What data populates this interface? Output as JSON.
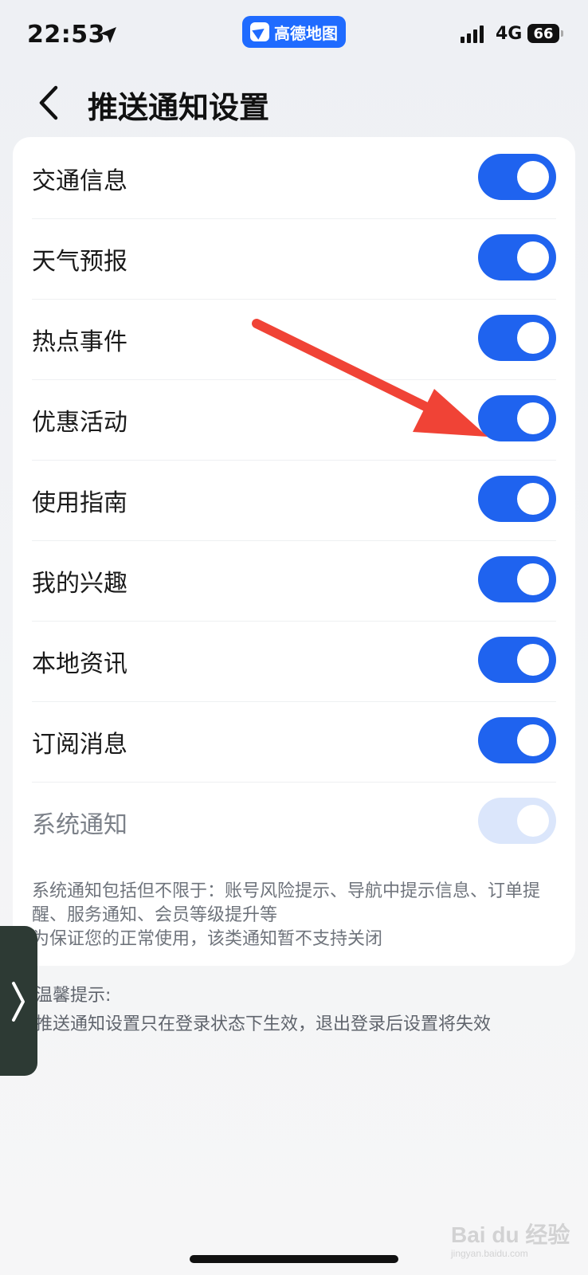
{
  "status_bar": {
    "time": "22:53",
    "app_badge": "高德地图",
    "network": "4G",
    "battery": "66"
  },
  "header": {
    "title": "推送通知设置"
  },
  "settings": [
    {
      "label": "交通信息",
      "enabled": true
    },
    {
      "label": "天气预报",
      "enabled": true
    },
    {
      "label": "热点事件",
      "enabled": true
    },
    {
      "label": "优惠活动",
      "enabled": true
    },
    {
      "label": "使用指南",
      "enabled": true
    },
    {
      "label": "我的兴趣",
      "enabled": true
    },
    {
      "label": "本地资讯",
      "enabled": true
    },
    {
      "label": "订阅消息",
      "enabled": true
    },
    {
      "label": "系统通知",
      "enabled": true,
      "locked": true
    }
  ],
  "system_note": {
    "line1": "系统通知包括但不限于：账号风险提示、导航中提示信息、订单提醒、服务通知、会员等级提升等",
    "line2": "为保证您的正常使用，该类通知暂不支持关闭"
  },
  "tips": {
    "heading": "温馨提示:",
    "body": "推送通知设置只在登录状态下生效，退出登录后设置将失效"
  },
  "watermark": {
    "brand": "Bai du 经验",
    "url": "jingyan.baidu.com"
  },
  "colors": {
    "accent": "#1f63ef",
    "disabled_toggle": "#dbe6fb",
    "arrow": "#f04336"
  }
}
